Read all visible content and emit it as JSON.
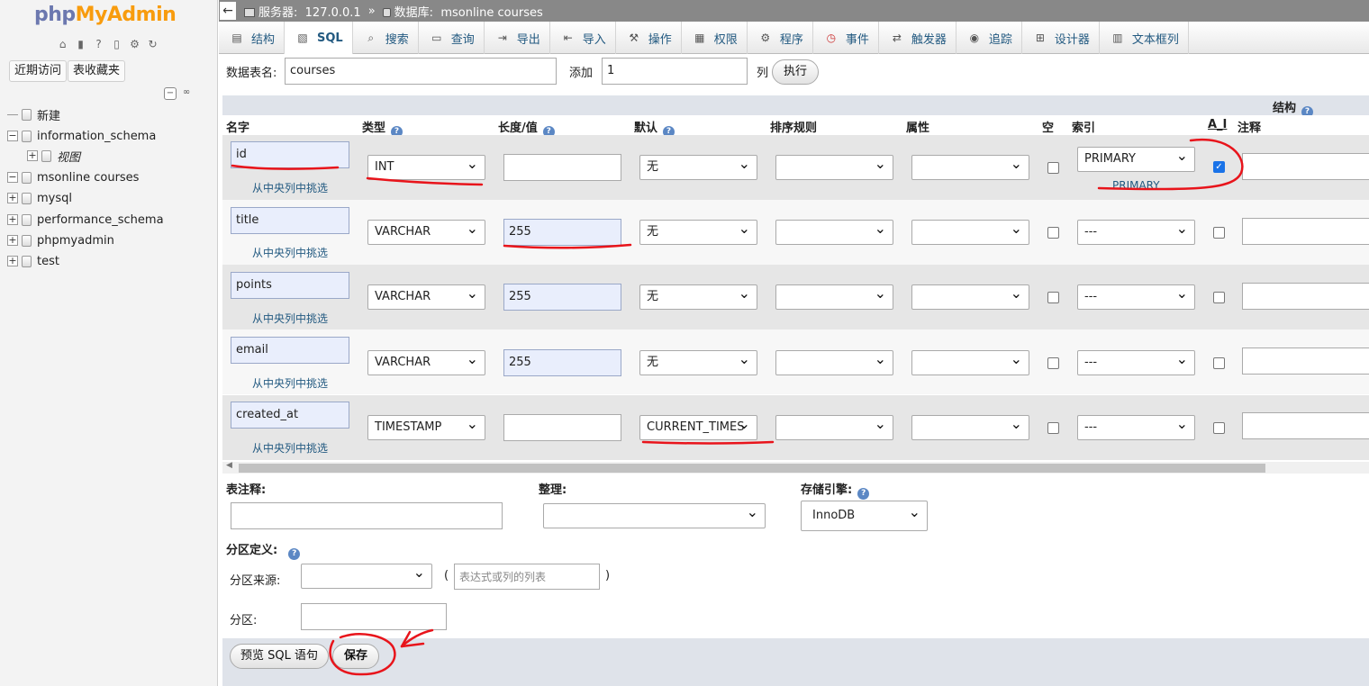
{
  "sidebar": {
    "logo_php": "php",
    "logo_myadmin": "MyAdmin",
    "icons": [
      "home-icon",
      "exit-icon",
      "help-icon",
      "docs-icon",
      "settings-icon",
      "reload-icon"
    ],
    "recent_button": "近期访问",
    "favorites_button": "表收藏夹",
    "tree": [
      {
        "label": "新建",
        "level": 0,
        "expander": "none"
      },
      {
        "label": "information_schema",
        "level": 0,
        "expander": "minus"
      },
      {
        "label": "视图",
        "level": 1,
        "expander": "plus"
      },
      {
        "label": "msonline courses",
        "level": 0,
        "expander": "minus"
      },
      {
        "label": "mysql",
        "level": 0,
        "expander": "plus"
      },
      {
        "label": "performance_schema",
        "level": 0,
        "expander": "plus"
      },
      {
        "label": "phpmyadmin",
        "level": 0,
        "expander": "plus"
      },
      {
        "label": "test",
        "level": 0,
        "expander": "plus"
      }
    ]
  },
  "breadcrumb": {
    "back": "←",
    "server_label": "服务器:",
    "server_value": "127.0.0.1",
    "separator": "»",
    "db_label": "数据库:",
    "db_value": "msonline courses"
  },
  "tabs": [
    {
      "label": "结构",
      "icon": "structure-icon"
    },
    {
      "label": "SQL",
      "icon": "sql-icon"
    },
    {
      "label": "搜索",
      "icon": "search-icon"
    },
    {
      "label": "查询",
      "icon": "query-icon"
    },
    {
      "label": "导出",
      "icon": "export-icon"
    },
    {
      "label": "导入",
      "icon": "import-icon"
    },
    {
      "label": "操作",
      "icon": "wrench-icon"
    },
    {
      "label": "权限",
      "icon": "privileges-icon"
    },
    {
      "label": "程序",
      "icon": "routines-icon"
    },
    {
      "label": "事件",
      "icon": "clock-icon"
    },
    {
      "label": "触发器",
      "icon": "triggers-icon"
    },
    {
      "label": "追踪",
      "icon": "eye-icon"
    },
    {
      "label": "设计器",
      "icon": "designer-icon"
    },
    {
      "label": "文本框列",
      "icon": "columns-icon"
    }
  ],
  "table_form": {
    "name_label": "数据表名:",
    "name_value": "courses",
    "add_label": "添加",
    "add_value": "1",
    "col_label": "列",
    "execute_button": "执行"
  },
  "structure_label": "结构",
  "columns": [
    "名字",
    "类型",
    "长度/值",
    "默认",
    "排序规则",
    "属性",
    "空",
    "索引",
    "A_I",
    "注释"
  ],
  "central_link": "从中央列中挑选",
  "fields": [
    {
      "name": "id",
      "type": "INT",
      "length": "",
      "default": "无",
      "collation": "",
      "attribute": "",
      "null": false,
      "index": "PRIMARY",
      "index_link": "PRIMARY",
      "ai": true,
      "comment": ""
    },
    {
      "name": "title",
      "type": "VARCHAR",
      "length": "255",
      "default": "无",
      "collation": "",
      "attribute": "",
      "null": false,
      "index": "---",
      "index_link": "",
      "ai": false,
      "comment": ""
    },
    {
      "name": "points",
      "type": "VARCHAR",
      "length": "255",
      "default": "无",
      "collation": "",
      "attribute": "",
      "null": false,
      "index": "---",
      "index_link": "",
      "ai": false,
      "comment": ""
    },
    {
      "name": "email",
      "type": "VARCHAR",
      "length": "255",
      "default": "无",
      "collation": "",
      "attribute": "",
      "null": false,
      "index": "---",
      "index_link": "",
      "ai": false,
      "comment": ""
    },
    {
      "name": "created_at",
      "type": "TIMESTAMP",
      "length": "",
      "default": "CURRENT_TIMES",
      "collation": "",
      "attribute": "",
      "null": false,
      "index": "---",
      "index_link": "",
      "ai": false,
      "comment": ""
    }
  ],
  "footer_form": {
    "table_comment_label": "表注释:",
    "collation_label": "整理:",
    "engine_label": "存储引擎:",
    "engine_value": "InnoDB",
    "partition_label": "分区定义:",
    "partition_by_label": "分区来源:",
    "expr_placeholder": "表达式或列的列表",
    "paren_open": "(",
    "paren_close": ")",
    "partitions_label": "分区:"
  },
  "buttons": {
    "preview_sql": "预览 SQL 语句",
    "save": "保存"
  },
  "annotation_color": "#e8141b"
}
